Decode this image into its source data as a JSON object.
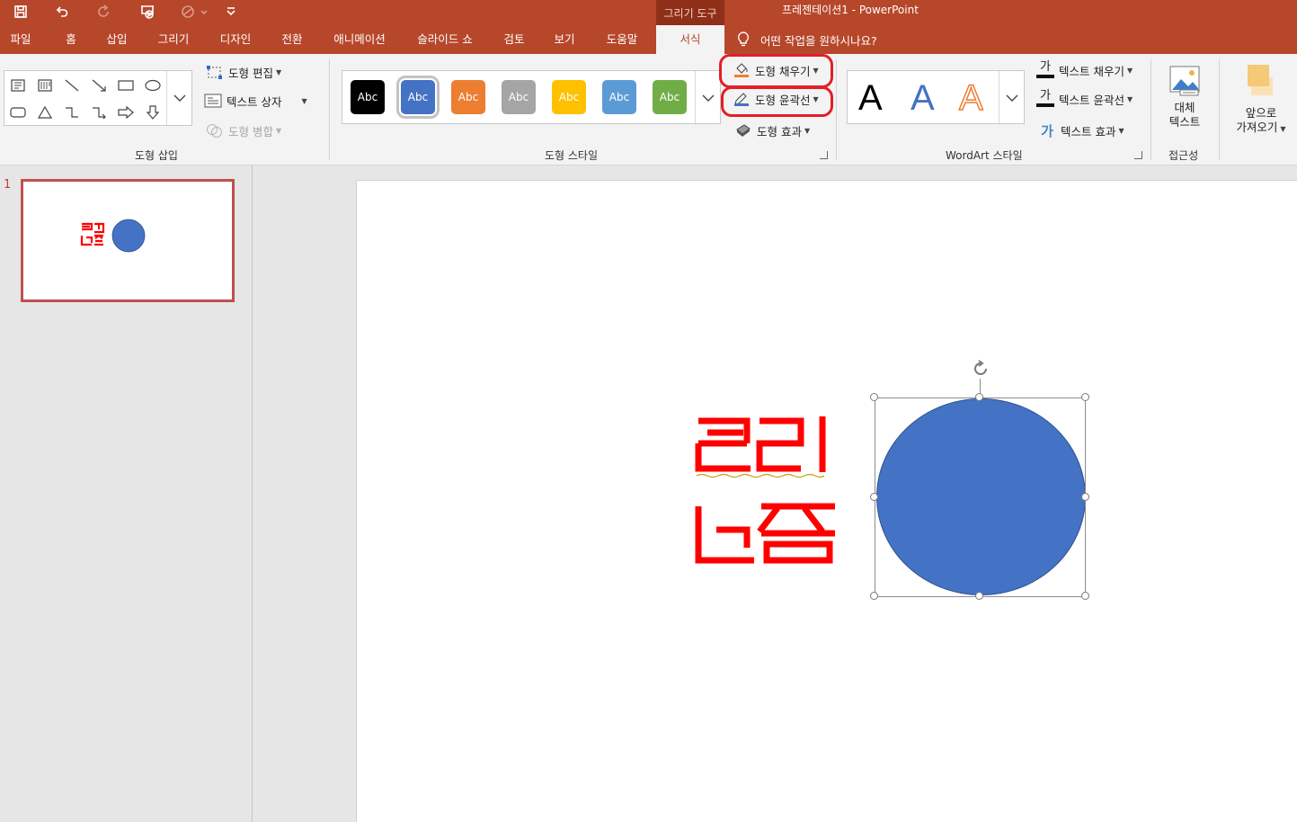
{
  "titlebar": {
    "context_tool_label": "그리기 도구",
    "app_title": "프레젠테이션1  -  PowerPoint",
    "quick_access": [
      "save-icon",
      "undo-icon",
      "redo-icon",
      "start-from-beginning-icon",
      "touch-mouse-mode-icon",
      "customize-quick-access-icon"
    ]
  },
  "tabs": [
    "파일",
    "홈",
    "삽입",
    "그리기",
    "디자인",
    "전환",
    "애니메이션",
    "슬라이드 쇼",
    "검토",
    "보기",
    "도움말",
    "서식"
  ],
  "active_tab": "서식",
  "tell_me": "어떤 작업을 원하시나요?",
  "ribbon": {
    "insert_shapes": {
      "label": "도형 삽입",
      "edit_shape": "도형 편집",
      "text_box": "텍스트 상자",
      "merge_shapes": "도형 병합"
    },
    "shape_styles": {
      "label": "도형 스타일",
      "swatch_text": "Abc",
      "swatch_colors": [
        "#000000",
        "#4472c4",
        "#ed7d31",
        "#a5a5a5",
        "#ffc000",
        "#5b9bd5",
        "#70ad47"
      ],
      "shape_fill": "도형 채우기",
      "shape_outline": "도형 윤곽선",
      "shape_effects": "도형 효과"
    },
    "wordart_styles": {
      "label": "WordArt 스타일",
      "letter": "A",
      "text_fill": "텍스트 채우기",
      "text_outline": "텍스트 윤곽선",
      "text_effects": "텍스트 효과",
      "text_icon_char": "가"
    },
    "accessibility": {
      "label": "접근성",
      "alt_text_line1": "대체",
      "alt_text_line2": "텍스트"
    },
    "arrange": {
      "bring_forward_line1": "앞으로",
      "bring_forward_line2": "가져오기"
    }
  },
  "thumbnails": {
    "slide_number": "1"
  },
  "slide": {
    "text_line1": "큐리",
    "text_line2": "노즘",
    "text_color": "#ff0000",
    "circle_color": "#4472c4"
  },
  "colors": {
    "accent": "#b7472a",
    "highlight": "#e41e26"
  }
}
